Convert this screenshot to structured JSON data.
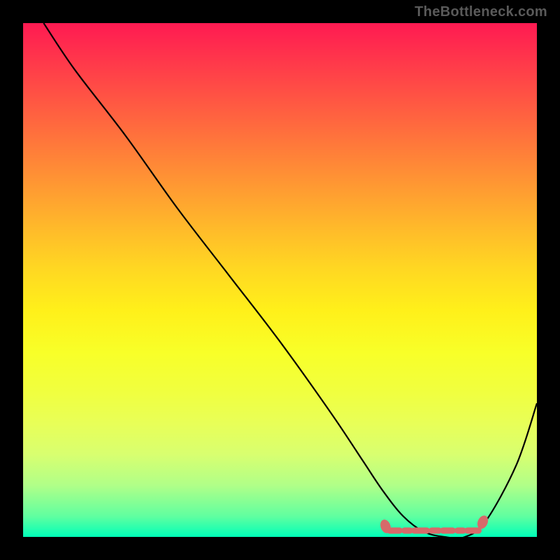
{
  "watermark": "TheBottleneck.com",
  "chart_data": {
    "type": "line",
    "title": "",
    "xlabel": "",
    "ylabel": "",
    "xlim": [
      0,
      100
    ],
    "ylim": [
      0,
      100
    ],
    "series": [
      {
        "name": "bottleneck-curve",
        "x": [
          4,
          10,
          20,
          30,
          40,
          50,
          60,
          66,
          70,
          74,
          78,
          82,
          86,
          90,
          96,
          100
        ],
        "y": [
          100,
          91,
          78,
          64,
          51,
          38,
          24,
          15,
          9,
          4,
          1,
          0,
          0,
          3,
          14,
          26
        ]
      }
    ],
    "markers": {
      "name": "highlight-band",
      "x_start": 70,
      "x_end": 90,
      "y": 1.5,
      "color": "#d66a6a"
    },
    "gradient_stops": [
      {
        "pos": 0,
        "color": "#ff1a52"
      },
      {
        "pos": 50,
        "color": "#fff01a"
      },
      {
        "pos": 100,
        "color": "#00ffb8"
      }
    ]
  }
}
